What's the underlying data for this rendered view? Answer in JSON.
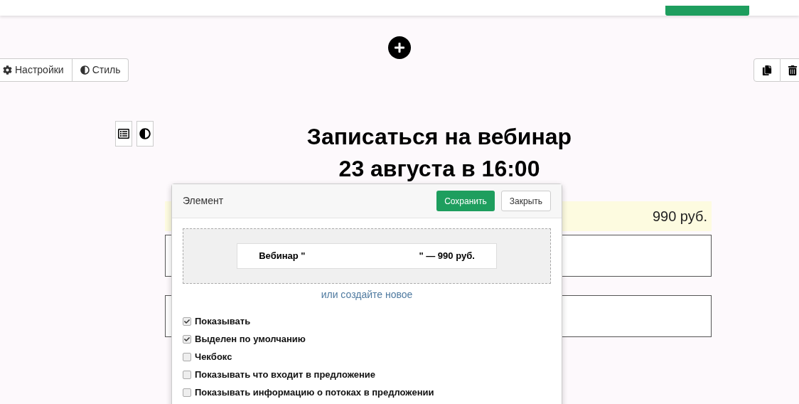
{
  "toolbar_left": [
    {
      "kind": "settings",
      "label": "Настройки"
    },
    {
      "kind": "style",
      "label": "Стиль"
    }
  ],
  "heading": [
    "Записаться на вебинар",
    "23 августа в 16:00"
  ],
  "price_row": {
    "price": "990 руб."
  },
  "modal": {
    "title": "Элемент",
    "save": "Сохранить",
    "close": "Закрыть",
    "product_start": "Вебинар \"",
    "product_end": "\" — 990 руб.",
    "create_link": "или создайте новое",
    "options": [
      {
        "label": "Показывать",
        "checked": true
      },
      {
        "label": "Выделен по умолчанию",
        "checked": true
      },
      {
        "label": "Чекбокс",
        "checked": false
      },
      {
        "label": "Показывать что входит в предложение",
        "checked": false
      },
      {
        "label": "Показывать информацию о потоках в предложении",
        "checked": false
      }
    ]
  }
}
